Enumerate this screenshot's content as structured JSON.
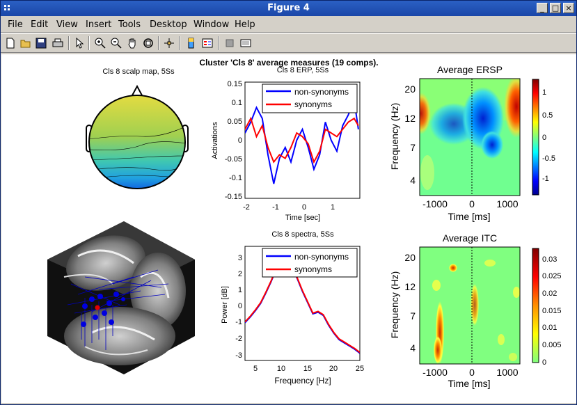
{
  "window": {
    "title": "Figure 4"
  },
  "menu": [
    "File",
    "Edit",
    "View",
    "Insert",
    "Tools",
    "Desktop",
    "Window",
    "Help"
  ],
  "toolbar": [
    "new-file-icon",
    "open-folder-icon",
    "save-icon",
    "print-icon",
    "pointer-icon",
    "zoom-in-icon",
    "zoom-out-icon",
    "pan-hand-icon",
    "rotate-3d-icon",
    "data-cursor-icon",
    "colorbar-icon",
    "legend-icon",
    "hide-tools-icon",
    "show-tools-icon"
  ],
  "figure": {
    "suptitle": "Cluster 'Cls 8' average measures (19 comps).",
    "scalp": {
      "title": "Cls 8 scalp map, 5Ss"
    },
    "erp": {
      "title": "Cls 8 ERP, 5Ss",
      "legend": [
        "non-synonyms",
        "synonyms"
      ],
      "ylabel": "Activations",
      "xlabel": "Time [sec]",
      "yticks": [
        "0.15",
        "0.1",
        "0.05",
        "0",
        "-0.05",
        "-0.1",
        "-0.15"
      ],
      "xticks": [
        "-2",
        "-1",
        "0",
        "1"
      ]
    },
    "ersp": {
      "title": "Average ERSP",
      "ylabel": "Frequency (Hz)",
      "xlabel": "Time [ms]",
      "yticks": [
        "20",
        "12",
        "7",
        "4"
      ],
      "xticks": [
        "-1000",
        "0",
        "1000"
      ],
      "cbticks": [
        "1",
        "0.5",
        "0",
        "-0.5",
        "-1"
      ]
    },
    "spectra": {
      "title": "Cls 8 spectra, 5Ss",
      "legend": [
        "non-synonyms",
        "synonyms"
      ],
      "ylabel": "Power [dB]",
      "xlabel": "Frequency [Hz]",
      "yticks": [
        "3",
        "2",
        "1",
        "0",
        "-1",
        "-2",
        "-3"
      ],
      "xticks": [
        "5",
        "10",
        "15",
        "20",
        "25"
      ]
    },
    "itc": {
      "title": "Average ITC",
      "ylabel": "Frequency (Hz)",
      "xlabel": "Time [ms]",
      "yticks": [
        "20",
        "12",
        "7",
        "4"
      ],
      "xticks": [
        "-1000",
        "0",
        "1000"
      ],
      "cbticks": [
        "0.03",
        "0.025",
        "0.02",
        "0.015",
        "0.01",
        "0.005",
        "0"
      ]
    }
  },
  "colors": {
    "non_synonyms": "#0000ff",
    "synonyms": "#ff0000",
    "titlebar": "#1f4fb5"
  },
  "chart_data": [
    {
      "type": "line",
      "title": "Cls 8 ERP, 5Ss",
      "xlabel": "Time [sec]",
      "ylabel": "Activations",
      "xlim": [
        -2,
        2
      ],
      "ylim": [
        -0.16,
        0.16
      ],
      "series": [
        {
          "name": "non-synonyms",
          "x": [
            -2.0,
            -1.8,
            -1.6,
            -1.4,
            -1.2,
            -1.0,
            -0.8,
            -0.6,
            -0.4,
            -0.2,
            0.0,
            0.2,
            0.4,
            0.6,
            0.8,
            1.0,
            1.2,
            1.4,
            1.6,
            1.8,
            1.95
          ],
          "y": [
            0.02,
            0.05,
            0.09,
            0.06,
            -0.04,
            -0.12,
            -0.05,
            -0.02,
            -0.06,
            0.0,
            0.03,
            -0.02,
            -0.08,
            -0.04,
            0.05,
            0.0,
            -0.03,
            0.04,
            0.07,
            0.11,
            0.03
          ]
        },
        {
          "name": "synonyms",
          "x": [
            -2.0,
            -1.8,
            -1.6,
            -1.4,
            -1.2,
            -1.0,
            -0.8,
            -0.6,
            -0.4,
            -0.2,
            0.0,
            0.2,
            0.4,
            0.6,
            0.8,
            1.0,
            1.2,
            1.4,
            1.6,
            1.8,
            1.95
          ],
          "y": [
            0.03,
            0.06,
            0.01,
            0.04,
            -0.02,
            -0.06,
            -0.04,
            -0.05,
            -0.02,
            0.02,
            0.01,
            -0.01,
            -0.06,
            -0.03,
            0.03,
            0.02,
            0.01,
            0.03,
            0.05,
            0.06,
            0.04
          ]
        }
      ]
    },
    {
      "type": "line",
      "title": "Cls 8 spectra, 5Ss",
      "xlabel": "Frequency [Hz]",
      "ylabel": "Power [dB]",
      "xlim": [
        3,
        25
      ],
      "ylim": [
        -3.3,
        3.8
      ],
      "series": [
        {
          "name": "non-synonyms",
          "x": [
            3,
            4,
            5,
            6,
            7,
            8,
            9,
            10,
            11,
            12,
            13,
            14,
            15,
            16,
            17,
            18,
            19,
            20,
            21,
            22,
            23,
            24,
            25
          ],
          "y": [
            -0.95,
            -0.6,
            -0.2,
            0.25,
            0.9,
            1.6,
            2.4,
            3.0,
            3.0,
            2.4,
            1.8,
            1.0,
            0.3,
            -0.4,
            -0.3,
            -0.5,
            -1.1,
            -1.6,
            -2.0,
            -2.2,
            -2.4,
            -2.6,
            -2.85
          ]
        },
        {
          "name": "synonyms",
          "x": [
            3,
            4,
            5,
            6,
            7,
            8,
            9,
            10,
            11,
            12,
            13,
            14,
            15,
            16,
            17,
            18,
            19,
            20,
            21,
            22,
            23,
            24,
            25
          ],
          "y": [
            -0.9,
            -0.55,
            -0.15,
            0.3,
            0.95,
            1.65,
            2.45,
            3.05,
            3.05,
            2.45,
            1.85,
            1.05,
            0.35,
            -0.35,
            -0.25,
            -0.45,
            -1.05,
            -1.55,
            -1.95,
            -2.15,
            -2.35,
            -2.55,
            -2.8
          ]
        }
      ]
    },
    {
      "type": "heatmap",
      "title": "Average ERSP",
      "xlabel": "Time [ms]",
      "ylabel": "Frequency (Hz)",
      "xlim": [
        -1500,
        1500
      ],
      "clim": [
        -1.3,
        1.3
      ],
      "yticks": [
        4,
        7,
        12,
        20
      ]
    },
    {
      "type": "heatmap",
      "title": "Average ITC",
      "xlabel": "Time [ms]",
      "ylabel": "Frequency (Hz)",
      "xlim": [
        -1500,
        1500
      ],
      "clim": [
        0,
        0.033
      ],
      "yticks": [
        4,
        7,
        12,
        20
      ]
    }
  ]
}
